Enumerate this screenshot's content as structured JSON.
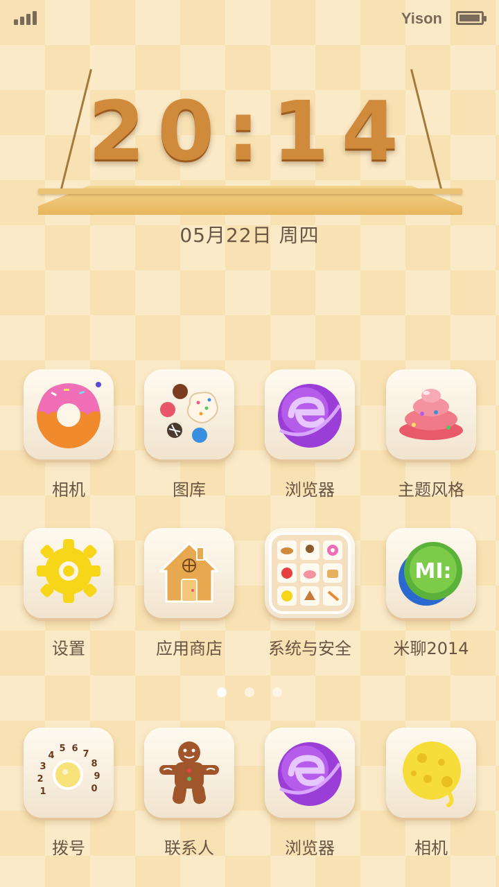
{
  "status_bar": {
    "carrier": "Yison",
    "battery_level": 0.85,
    "signal_bars": 4
  },
  "clock": {
    "time": "20:14",
    "date": "05月22日  周四"
  },
  "grid": [
    {
      "label": "相机",
      "icon": "donut-icon"
    },
    {
      "label": "图库",
      "icon": "candies-icon"
    },
    {
      "label": "浏览器",
      "icon": "browser-candy-icon"
    },
    {
      "label": "主题风格",
      "icon": "cupcake-icon"
    },
    {
      "label": "设置",
      "icon": "gear-icon"
    },
    {
      "label": "应用商店",
      "icon": "gingerbread-house-icon"
    },
    {
      "label": "系统与安全",
      "icon": "folder-icon"
    },
    {
      "label": "米聊2014",
      "icon": "miliao-icon"
    }
  ],
  "pager": {
    "pages": 3,
    "current": 1
  },
  "dock": [
    {
      "label": "拨号",
      "icon": "dialer-icon"
    },
    {
      "label": "联系人",
      "icon": "gingerbread-man-icon"
    },
    {
      "label": "浏览器",
      "icon": "browser-candy-icon"
    },
    {
      "label": "相机",
      "icon": "cheese-icon"
    }
  ],
  "colors": {
    "background": "#f8e2b3",
    "text": "#6a5544",
    "accent": "#cf8a3c"
  }
}
